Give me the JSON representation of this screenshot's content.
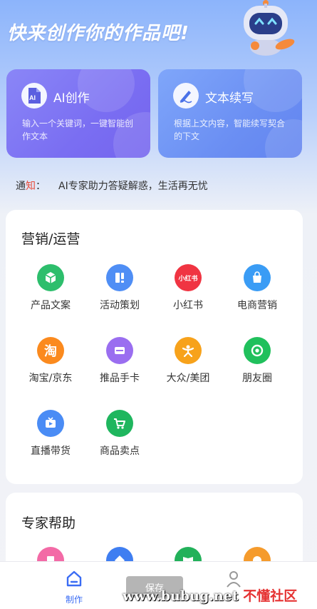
{
  "hero": {
    "title": "快来创作你的作品吧!"
  },
  "cards": [
    {
      "title": "AI创作",
      "desc": "输入一个关键词，一键智能创作文本",
      "icon": "ai-doc-icon"
    },
    {
      "title": "文本续写",
      "desc": "根据上文内容，智能续写契合的下文",
      "icon": "pen-icon"
    }
  ],
  "notice": {
    "label_a": "通",
    "label_b": "知",
    "colon": "：",
    "text": "AI专家助力答疑解惑，生活再无忧"
  },
  "marketing": {
    "title": "营销/运营",
    "items": [
      {
        "label": "产品文案",
        "color": "#2dbe6c",
        "icon": "cube-icon"
      },
      {
        "label": "活动策划",
        "color": "#4f8ef5",
        "icon": "plan-icon"
      },
      {
        "label": "小红书",
        "color": "#f03442",
        "icon": "xiaohongshu-icon",
        "badge": "小红书"
      },
      {
        "label": "电商营销",
        "color": "#3a9cf5",
        "icon": "shopping-bag-icon"
      },
      {
        "label": "淘宝/京东",
        "color": "#fb8a1e",
        "icon": "taobao-icon",
        "badge": "淘"
      },
      {
        "label": "推品手卡",
        "color": "#9a6ef0",
        "icon": "card-icon"
      },
      {
        "label": "大众/美团",
        "color": "#f7a21b",
        "icon": "dianping-icon"
      },
      {
        "label": "朋友圈",
        "color": "#20c05c",
        "icon": "moments-icon"
      },
      {
        "label": "直播带货",
        "color": "#4a8cf5",
        "icon": "tv-icon"
      },
      {
        "label": "商品卖点",
        "color": "#1fb65e",
        "icon": "cart-icon"
      }
    ]
  },
  "experts": {
    "title": "专家帮助",
    "items": [
      {
        "color": "#f36aa6",
        "icon": "expert-icon-1"
      },
      {
        "color": "#3f7ef1",
        "icon": "expert-icon-2"
      },
      {
        "color": "#22b15a",
        "icon": "book-icon"
      },
      {
        "color": "#f59b2c",
        "icon": "flower-icon"
      }
    ]
  },
  "tabbar": {
    "tabs": [
      {
        "label": "制作"
      },
      {
        "label": ""
      }
    ]
  },
  "toast": {
    "text": "保存"
  },
  "watermark": {
    "url": "www.bubug.net",
    "brand": "不懂社区"
  }
}
